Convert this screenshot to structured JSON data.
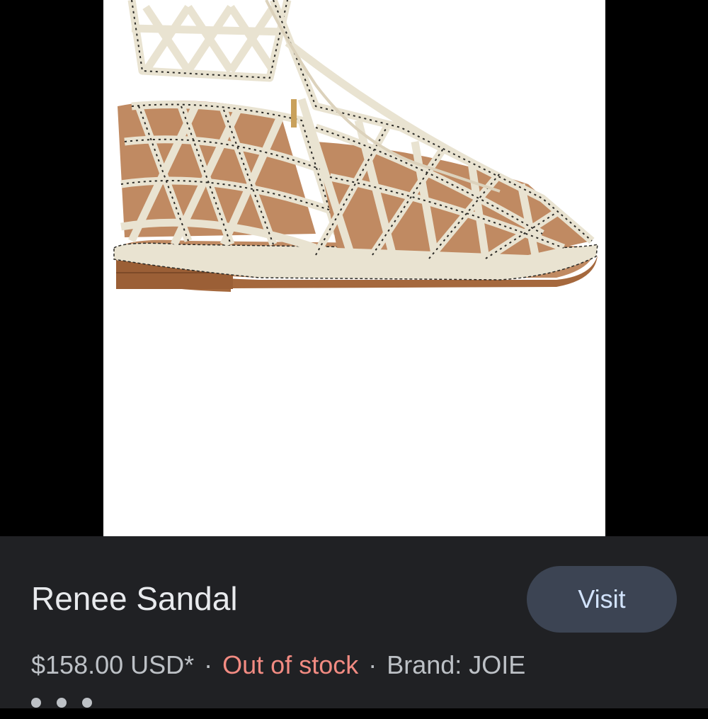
{
  "image": {
    "subject": "sandal-photo",
    "colors": {
      "leather": "#e9e3d1",
      "pattern": "#2b2a26",
      "sole": "#a5683d",
      "insole": "#c08a62"
    }
  },
  "product": {
    "title": "Renee Sandal",
    "price": "$158.00 USD*",
    "separator": "·",
    "stock": "Out of stock",
    "brand": "Brand: JOIE"
  },
  "actions": {
    "visit_label": "Visit"
  },
  "colors": {
    "panel_bg": "#202124",
    "button_bg": "#3c4453",
    "button_text": "#d2e3fc",
    "stock_red": "#f28b82"
  }
}
